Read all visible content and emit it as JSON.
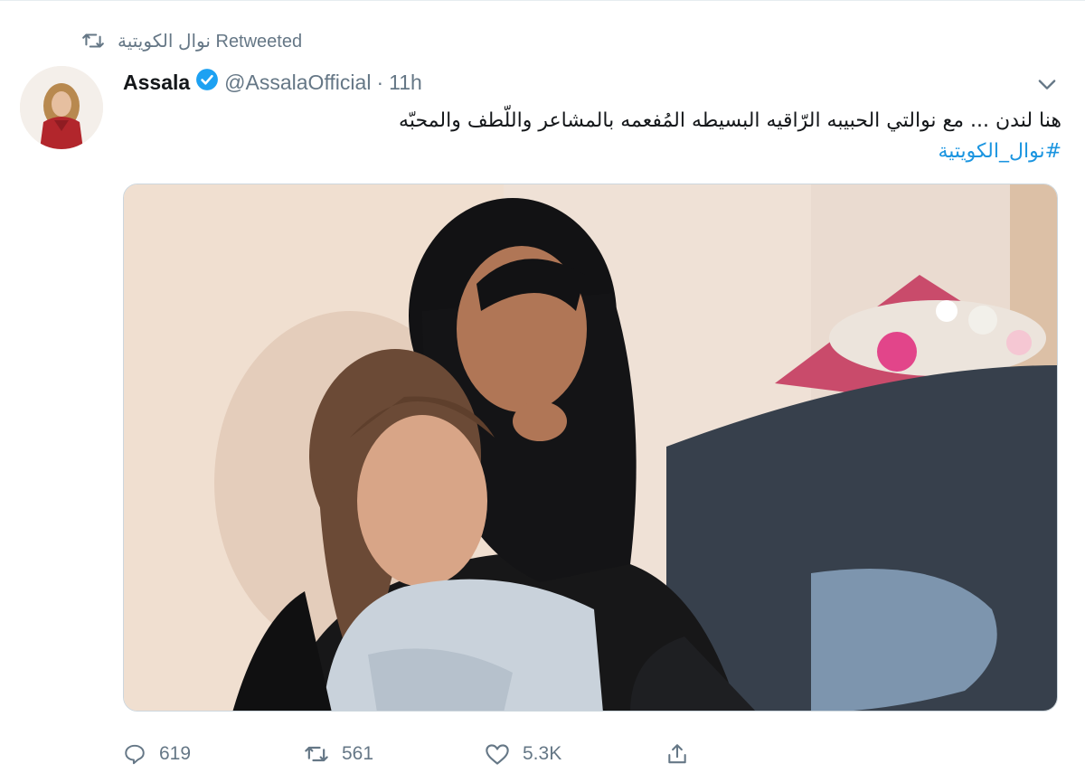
{
  "retweet": {
    "icon": "retweet-icon",
    "label": "نوال الكويتية Retweeted"
  },
  "author": {
    "name": "Assala",
    "verified": true,
    "handle": "@AssalaOfficial",
    "separator": "·",
    "time": "11h"
  },
  "tweet": {
    "text": "هنا لندن ... مع نوالتي الحبيبه الرّاقيه البسيطه المُفعمه بالمشاعر واللّطف والمحبّه",
    "hashtag": "#نوال_الكويتية"
  },
  "actions": {
    "reply_count": "619",
    "retweet_count": "561",
    "like_count": "5.3K"
  },
  "colors": {
    "accent": "#1da1f2",
    "hashtag": "#1b95e0",
    "muted": "#657786",
    "border": "#e6ecf0"
  }
}
